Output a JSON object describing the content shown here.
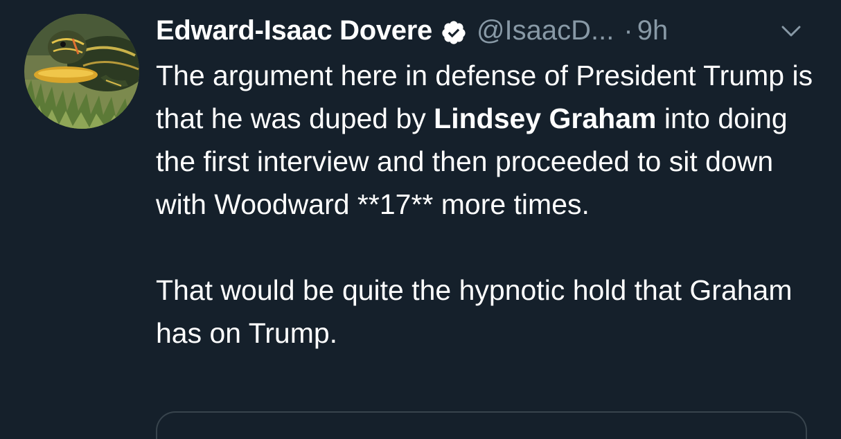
{
  "tweet": {
    "author": {
      "name": "Edward-Isaac Dovere",
      "handle": "@IsaacD...",
      "verified": true,
      "verified_icon": "verified-badge-icon",
      "avatar_icon": "turtle-avatar"
    },
    "separator": "·",
    "time": "9h",
    "menu_icon": "chevron-down-icon",
    "text": {
      "p1_part1": "The argument here in defense of President Trump is that he was duped by ",
      "mention": "Lindsey Graham",
      "p1_part2": " into doing the first interview and then proceeded to sit down with Woodward **17** more times.",
      "p2": "That would be quite the hypnotic hold that Graham has on Trump."
    }
  },
  "colors": {
    "background": "#15202b",
    "primary_text": "#ffffff",
    "secondary_text": "#8899a6",
    "border": "#38444d"
  }
}
